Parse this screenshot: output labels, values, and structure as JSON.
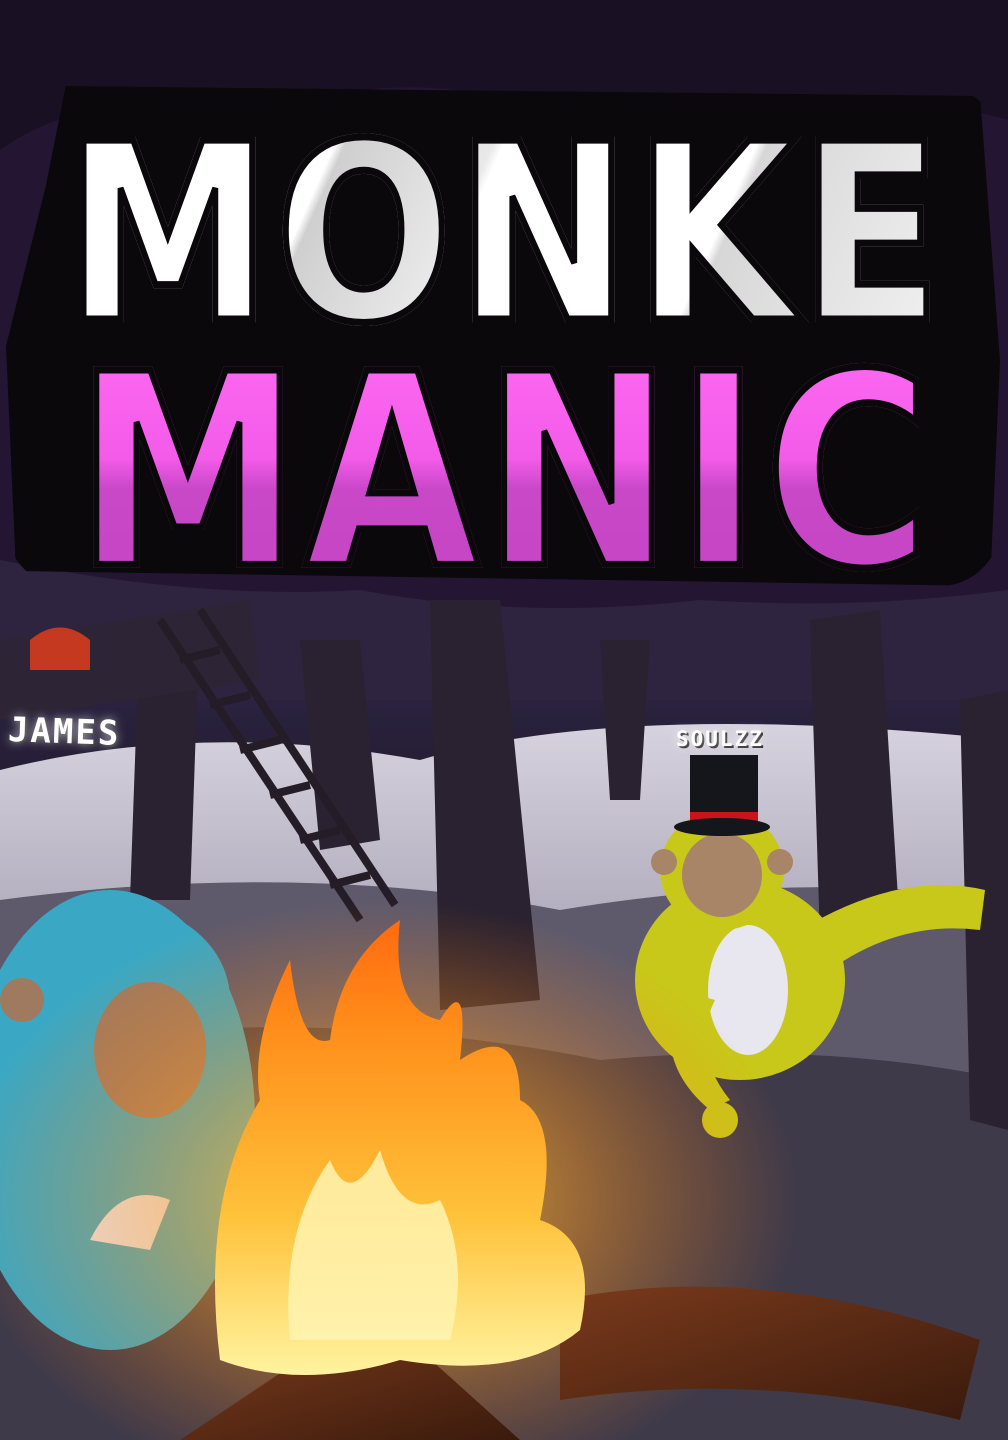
{
  "game": {
    "title_line1": "MONKE",
    "title_line2": "MANIC"
  },
  "players": [
    {
      "name": "JAMES",
      "fur_color": "#3aa8c4"
    },
    {
      "name": "SOULZZ",
      "fur_color": "#c8c81a"
    }
  ],
  "colors": {
    "title_white": "#f2f2f2",
    "title_magenta": "#f35be9",
    "outline": "#0b080c",
    "fire": "#ffb020",
    "snow": "#c9c6d3"
  },
  "icons": [
    "campfire-icon",
    "top-hat-icon",
    "ladder-icon",
    "tree-icon"
  ]
}
